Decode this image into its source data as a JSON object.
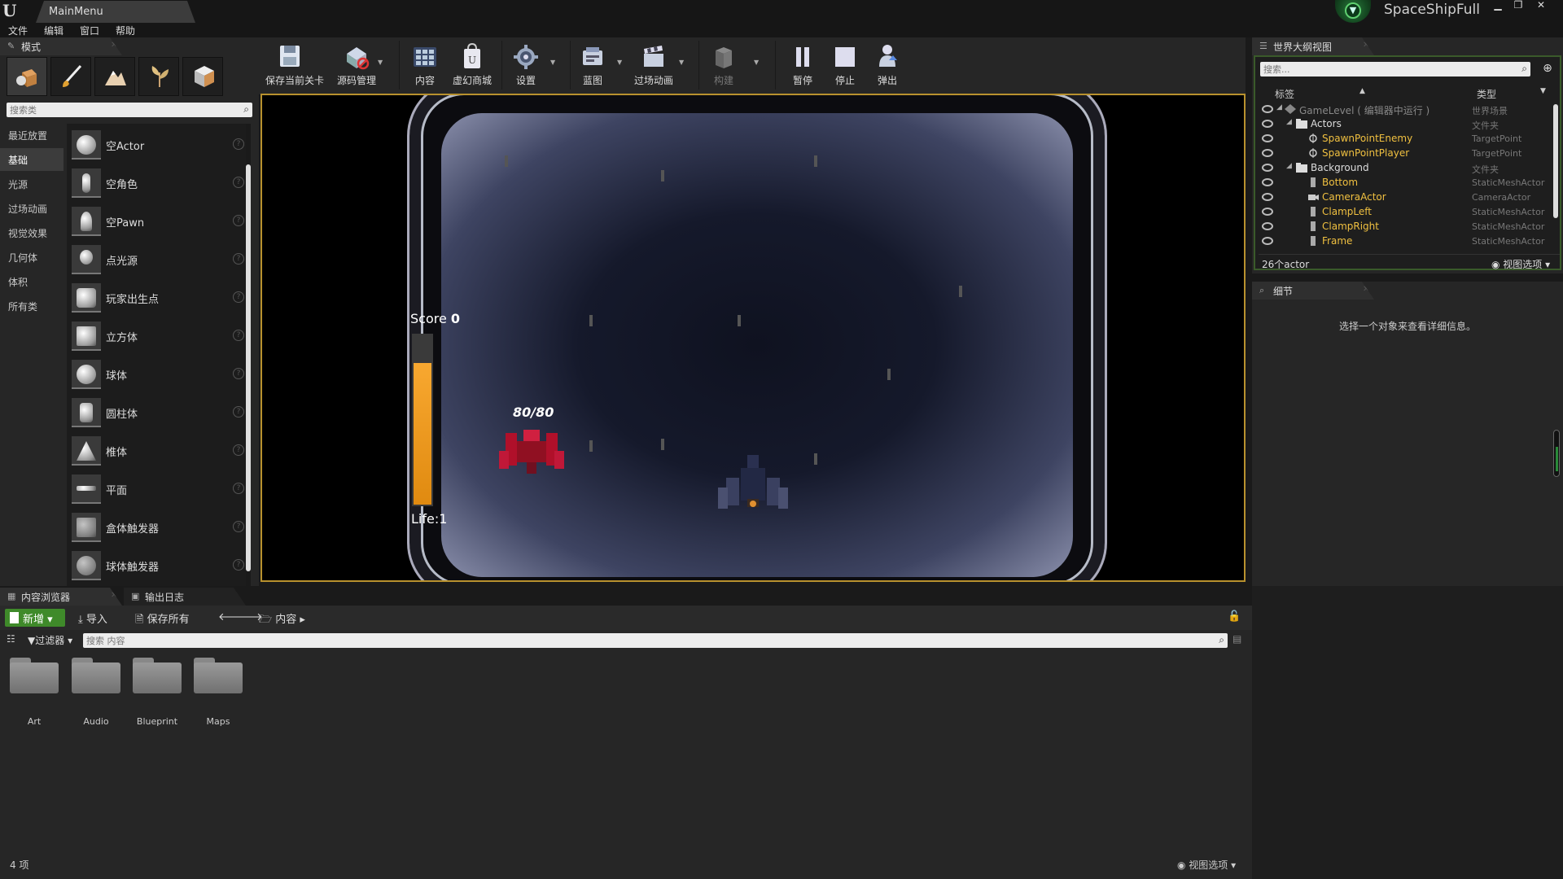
{
  "titlebar": {
    "tab_title": "MainMenu",
    "project_name": "SpaceShipFull",
    "min_btn": "▁",
    "max_btn": "❐",
    "close_btn": "✕"
  },
  "menubar": {
    "items": [
      "文件",
      "编辑",
      "窗口",
      "帮助"
    ]
  },
  "modes": {
    "tab_label": "模式",
    "search_placeholder": "搜索类",
    "categories": [
      "最近放置",
      "基础",
      "光源",
      "过场动画",
      "视觉效果",
      "几何体",
      "体积",
      "所有类"
    ],
    "active_category": "基础",
    "classes": [
      "空Actor",
      "空角色",
      "空Pawn",
      "点光源",
      "玩家出生点",
      "立方体",
      "球体",
      "圆柱体",
      "椎体",
      "平面",
      "盒体触发器",
      "球体触发器"
    ]
  },
  "toolbar": {
    "buttons": [
      "保存当前关卡",
      "源码管理",
      "内容",
      "虚幻商城",
      "设置",
      "蓝图",
      "过场动画",
      "构建",
      "暂停",
      "停止",
      "弹出"
    ]
  },
  "viewport": {
    "score_label": "Score",
    "score_value": "0",
    "life_text": "Life:1",
    "enemy_hp": "80/80",
    "life_fill_fraction": 0.82
  },
  "outliner": {
    "tab_label": "世界大纲视图",
    "search_placeholder": "搜索...",
    "col_label": "标签",
    "col_type": "类型",
    "rows": [
      {
        "label": "GameLevel ( 编辑器中运行 )",
        "type": "世界场景",
        "kind": "level"
      },
      {
        "label": "Actors",
        "type": "文件夹",
        "kind": "folder"
      },
      {
        "label": "SpawnPointEnemy",
        "type": "TargetPoint",
        "kind": "actor"
      },
      {
        "label": "SpawnPointPlayer",
        "type": "TargetPoint",
        "kind": "actor"
      },
      {
        "label": "Background",
        "type": "文件夹",
        "kind": "folder"
      },
      {
        "label": "Bottom",
        "type": "StaticMeshActor",
        "kind": "actor"
      },
      {
        "label": "CameraActor",
        "type": "CameraActor",
        "kind": "actor"
      },
      {
        "label": "ClampLeft",
        "type": "StaticMeshActor",
        "kind": "actor"
      },
      {
        "label": "ClampRight",
        "type": "StaticMeshActor",
        "kind": "actor"
      },
      {
        "label": "Frame",
        "type": "StaticMeshActor",
        "kind": "actor"
      }
    ],
    "count": "26个actor",
    "view_options": "视图选项"
  },
  "details": {
    "tab_label": "细节",
    "message": "选择一个对象来查看详细信息。"
  },
  "bottom": {
    "tabs": [
      "内容浏览器",
      "输出日志"
    ],
    "new_label": "新增",
    "import_label": "导入",
    "save_all_label": "保存所有",
    "path_label": "内容",
    "filter_label": "过滤器",
    "search_placeholder": "搜索 内容",
    "folders": [
      "Art",
      "Audio",
      "Blueprint",
      "Maps"
    ],
    "item_count": "4 项",
    "view_options": "视图选项"
  },
  "colors": {
    "viewport_border": "#b8912e",
    "new_button": "#3f8a2a",
    "actor_label": "#f0c040",
    "life_bar": "#f0a020"
  }
}
